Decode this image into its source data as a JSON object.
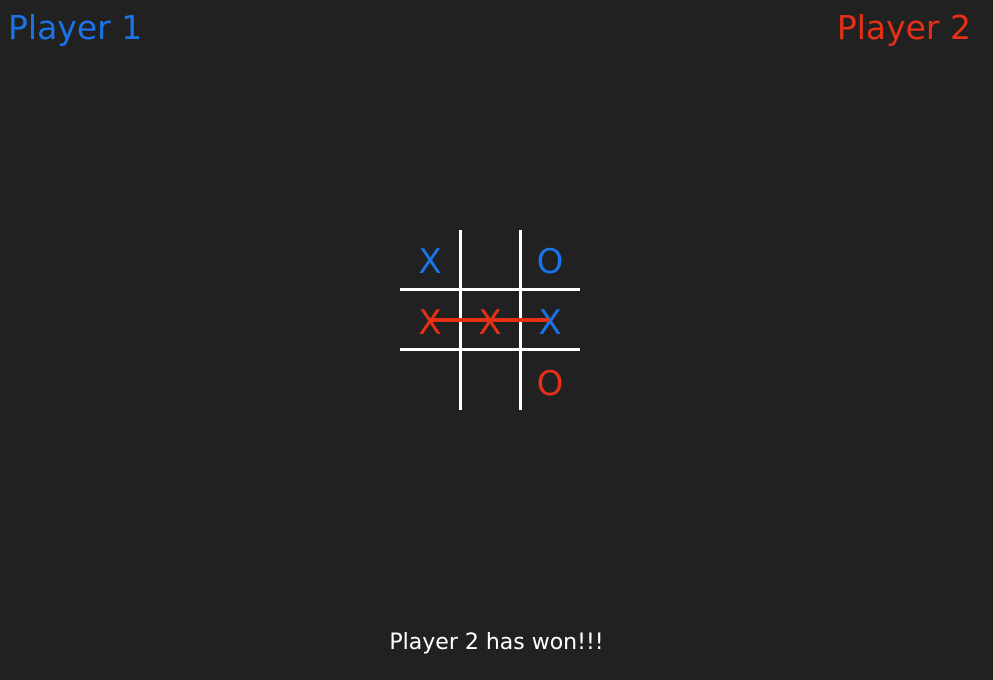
{
  "colors": {
    "background": "#212121",
    "player1": "#1a73e8",
    "player2": "#e53016",
    "grid": "#ffffff",
    "text": "#ffffff"
  },
  "players": {
    "player1_label": "Player 1",
    "player2_label": "Player 2"
  },
  "board": {
    "cells": [
      {
        "mark": "X",
        "owner": "player1"
      },
      {
        "mark": "",
        "owner": ""
      },
      {
        "mark": "O",
        "owner": "player1"
      },
      {
        "mark": "X",
        "owner": "player2"
      },
      {
        "mark": "X",
        "owner": "player2"
      },
      {
        "mark": "X",
        "owner": "player1"
      },
      {
        "mark": "",
        "owner": ""
      },
      {
        "mark": "",
        "owner": ""
      },
      {
        "mark": "O",
        "owner": "player2"
      }
    ],
    "winning_row": 1,
    "winner_color": "#e53016"
  },
  "status": {
    "message": "Player 2 has won!!!"
  }
}
